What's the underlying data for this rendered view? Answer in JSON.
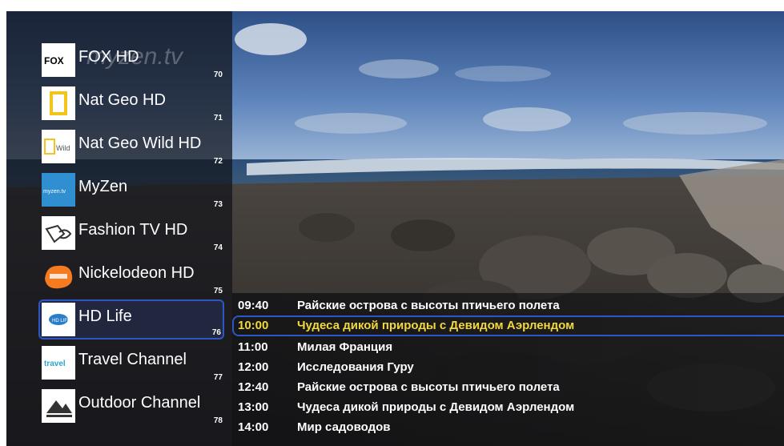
{
  "watermark": "myzen.tv",
  "channels": [
    {
      "name": "FOX HD",
      "number": "70",
      "logo": "fox-logo-icon",
      "logo_text": "FOX"
    },
    {
      "name": "Nat Geo HD",
      "number": "71",
      "logo": "nat-geo-logo-icon",
      "logo_text": ""
    },
    {
      "name": "Nat Geo Wild HD",
      "number": "72",
      "logo": "nat-geo-wild-logo-icon",
      "logo_text": "Wild"
    },
    {
      "name": "MyZen",
      "number": "73",
      "logo": "myzen-logo-icon",
      "logo_text": "myzen.tv"
    },
    {
      "name": "Fashion TV HD",
      "number": "74",
      "logo": "fashion-tv-logo-icon",
      "logo_text": ""
    },
    {
      "name": "Nickelodeon HD",
      "number": "75",
      "logo": "nickelodeon-logo-icon",
      "logo_text": ""
    },
    {
      "name": "HD Life",
      "number": "76",
      "logo": "hd-life-logo-icon",
      "logo_text": "HD LIFE",
      "selected": true
    },
    {
      "name": "Travel Channel",
      "number": "77",
      "logo": "travel-channel-logo-icon",
      "logo_text": "travel"
    },
    {
      "name": "Outdoor Channel",
      "number": "78",
      "logo": "outdoor-channel-logo-icon",
      "logo_text": ""
    }
  ],
  "epg": [
    {
      "time": "09:40",
      "title": "Райские острова с высоты птичьего полета"
    },
    {
      "time": "10:00",
      "title": "Чудеса дикой природы с Девидом Аэрлендом",
      "current": true
    },
    {
      "time": "11:00",
      "title": "Милая Франция"
    },
    {
      "time": "12:00",
      "title": "Исследования Гуру"
    },
    {
      "time": "12:40",
      "title": "Райские острова с высоты птичьего полета"
    },
    {
      "time": "13:00",
      "title": "Чудеса дикой природы с Девидом Аэрлендом"
    },
    {
      "time": "14:00",
      "title": "Мир садоводов"
    }
  ],
  "colors": {
    "selection_border": "#2f56c6",
    "current_program": "#f2d83a"
  }
}
